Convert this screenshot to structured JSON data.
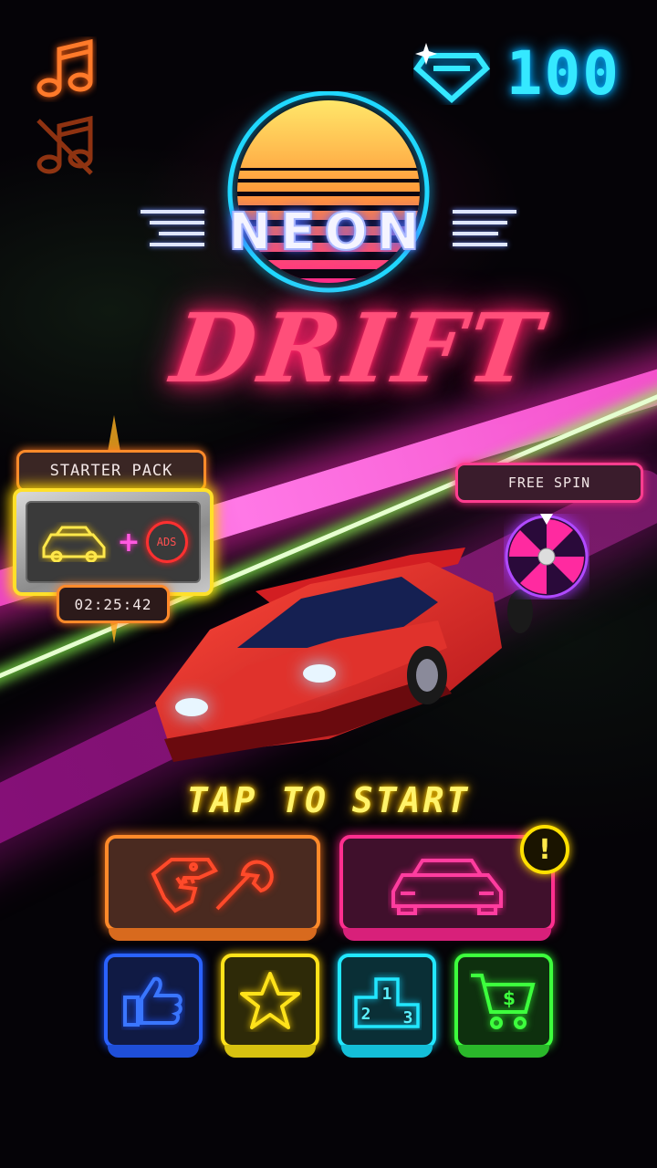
{
  "gems": {
    "count": "100",
    "icon": "diamond-icon",
    "color": "#35e8ff"
  },
  "logo": {
    "line1": "NEON",
    "line2": "DRIFT"
  },
  "audio": {
    "music_on_icon": "music-note-icon",
    "music_off_icon": "music-muted-icon"
  },
  "starter_pack": {
    "title": "STARTER PACK",
    "ads_label": "ADS",
    "timer": "02:25:42"
  },
  "free_spin": {
    "label": "FREE SPIN"
  },
  "prompt": {
    "tap_to_start": "TAP TO START"
  },
  "buttons": {
    "garage": {
      "icon": "dino-wrench-icon",
      "color": "#ff8a2a"
    },
    "cars": {
      "icon": "car-icon",
      "color": "#ff2f8f",
      "alert": "!"
    },
    "like": {
      "icon": "thumbs-up-icon",
      "color": "#2a62ff"
    },
    "rate": {
      "icon": "star-icon",
      "color": "#ffe21a"
    },
    "leaderboard": {
      "icon": "podium-icon",
      "color": "#22e7ff",
      "places": [
        "1",
        "2",
        "3"
      ]
    },
    "shop": {
      "icon": "shopping-cart-icon",
      "color": "#3dff3d",
      "symbol": "$"
    }
  }
}
